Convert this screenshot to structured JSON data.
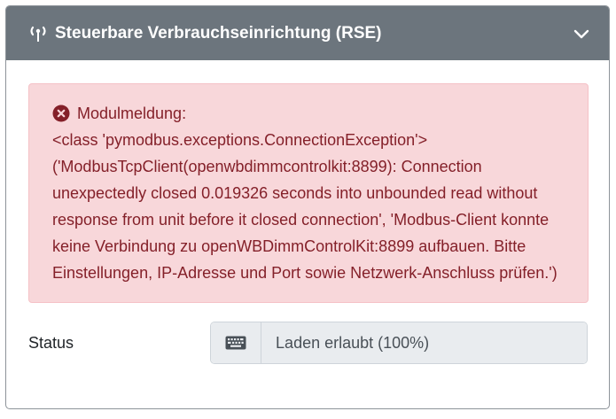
{
  "header": {
    "title": "Steuerbare Verbrauchseinrichtung (RSE)",
    "icon": "antenna-signal-icon",
    "toggle_icon": "chevron-down-icon",
    "background": "#6c757d"
  },
  "alert": {
    "icon": "error-circle-icon",
    "title": "Modulmeldung:",
    "message": "<class 'pymodbus.exceptions.ConnectionException'> ('ModbusTcpClient(openwbdimmcontrolkit:8899): Connection unexpectedly closed 0.019326 seconds into unbounded read without response from unit before it closed connection', 'Modbus-Client konnte keine Verbindung zu openWBDimmControlKit:8899 aufbauen. Bitte Einstellungen, IP-Adresse und Port sowie Netzwerk-Anschluss prüfen.')",
    "background": "#f8d7da",
    "text_color": "#842029"
  },
  "status": {
    "label": "Status",
    "addon_icon": "keyboard-icon",
    "value": "Laden erlaubt (100%)"
  }
}
